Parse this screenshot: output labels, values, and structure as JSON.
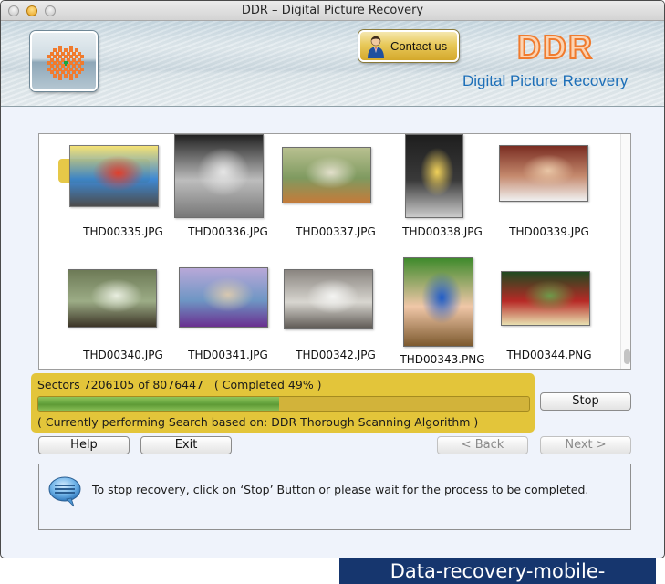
{
  "window": {
    "title": "DDR – Digital Picture Recovery"
  },
  "banner": {
    "logo_icon": "ddr-logo-icon",
    "contact_button_label": "Contact us",
    "contact_icon": "person-icon",
    "brand_mark": "DDR",
    "brand_subtitle": "Digital Picture Recovery",
    "brand_color": "#f07b2e",
    "subtitle_color": "#1d6fb8"
  },
  "gallery": {
    "items": [
      {
        "filename": "THD00335.JPG",
        "selected": true
      },
      {
        "filename": "THD00336.JPG",
        "selected": false
      },
      {
        "filename": "THD00337.JPG",
        "selected": false
      },
      {
        "filename": "THD00338.JPG",
        "selected": false
      },
      {
        "filename": "THD00339.JPG",
        "selected": false
      },
      {
        "filename": "THD00340.JPG",
        "selected": false
      },
      {
        "filename": "THD00341.JPG",
        "selected": false
      },
      {
        "filename": "THD00342.JPG",
        "selected": false
      },
      {
        "filename": "THD00343.PNG",
        "selected": false
      },
      {
        "filename": "THD00344.PNG",
        "selected": false
      }
    ]
  },
  "progress": {
    "sectors_line": "Sectors 7206105 of 8076447   ( Completed 49% )",
    "sectors_done": 7206105,
    "sectors_total": 8076447,
    "percent_complete": 49,
    "status_line": "( Currently performing Search based on: DDR Thorough Scanning Algorithm )",
    "panel_color": "#e3c53a",
    "fill_color": "#6aa842"
  },
  "buttons": {
    "stop": "Stop",
    "help": "Help",
    "exit": "Exit",
    "back": "< Back",
    "next": "Next >"
  },
  "info": {
    "icon": "speech-bubble-icon",
    "message": "To stop recovery, click on ‘Stop’ Button or please wait for the process to be completed."
  },
  "watermark": {
    "text": "Data-recovery-mobile-phone.com"
  }
}
